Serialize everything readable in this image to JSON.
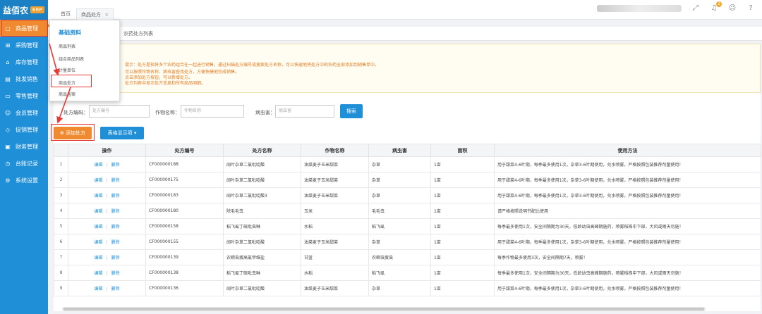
{
  "brand": {
    "name": "益佰农",
    "badge": "ERP"
  },
  "sidebar": {
    "items": [
      {
        "label": "商品管理",
        "icon": "box-icon",
        "active": true
      },
      {
        "label": "采购管理",
        "icon": "cart-icon"
      },
      {
        "label": "库存管理",
        "icon": "warehouse-icon"
      },
      {
        "label": "批发销售",
        "icon": "chart-icon"
      },
      {
        "label": "零售管理",
        "icon": "shop-icon"
      },
      {
        "label": "会员管理",
        "icon": "users-icon"
      },
      {
        "label": "促销管理",
        "icon": "tag-icon"
      },
      {
        "label": "财务管理",
        "icon": "finance-icon"
      },
      {
        "label": "台账记录",
        "icon": "ledger-icon"
      },
      {
        "label": "系统设置",
        "icon": "gear-icon"
      }
    ]
  },
  "topbar": {
    "tabs": [
      {
        "label": "首页"
      },
      {
        "label": "商品处方"
      }
    ],
    "close_glyph": "×",
    "notification_count": "2"
  },
  "subtabs": {
    "active": "农药处方列表"
  },
  "dropdown": {
    "title": "基础资料",
    "items": [
      "商品列表",
      "组合商品列表",
      "计量单位",
      "商品处方",
      "商品备案"
    ]
  },
  "notice": {
    "line1": "提示：处方是指将多个农药组合在一起进行销售，通过扫描处方编号或搜索处方名称，可以快速地将处方中的农药全部添加到销售单中。",
    "line2": "可以按照作物名称、病虫害查找处方，方便快捷地完成销售。",
    "line3": "点击添加处方按钮，可以新增处方。",
    "line4": "处方列表中显示处方信息和所有商品明细。"
  },
  "search": {
    "code_label": "处方编码：",
    "code_placeholder": "处方编号",
    "crop_label": "作物名称：",
    "crop_placeholder": "作物名称",
    "pest_label": "病虫害：",
    "pest_placeholder": "病虫害",
    "button": "搜索"
  },
  "actions": {
    "add": "添加处方",
    "columns": "表格显示项 ▾"
  },
  "table": {
    "headers": [
      "",
      "操作",
      "处方编号",
      "处方名称",
      "作物名称",
      "病虫害",
      "面积",
      "使用方法"
    ],
    "edit_label": "编辑",
    "delete_label": "删除",
    "rows": [
      {
        "n": "1",
        "code": "CF000000188",
        "name": "阔叶杂草二氯吡啶酸",
        "crop": "油菜麦子玉米甜菜",
        "pest": "杂草",
        "area": "1亩",
        "method": "用于甜菜4-6叶期，每季最多使用1次，杂草3-6叶期使用，兑水喷雾，严格按照包装推荐剂量使用！"
      },
      {
        "n": "2",
        "code": "CF000000175",
        "name": "阔叶杂草二氯吡啶酸",
        "crop": "油菜麦子玉米甜菜",
        "pest": "杂草",
        "area": "1亩",
        "method": "用于甜菜4-6叶期，每季最多使用1次，杂草3-6叶期使用，兑水喷雾，严格按照包装推荐剂量使用！"
      },
      {
        "n": "3",
        "code": "CF000000183",
        "name": "阔叶杂草二氯吡啶酸3",
        "crop": "油菜麦子玉米甜菜",
        "pest": "杂草",
        "area": "1亩",
        "method": "用于甜菜4-6叶期，每季最多使用1次，杂草3-6叶期使用，兑水喷雾，严格按照包装推荐剂量使用！"
      },
      {
        "n": "4",
        "code": "CF000000180",
        "name": "除毛毛虫",
        "crop": "玉米",
        "pest": "毛毛虫",
        "area": "1亩",
        "method": "请严格按照说明书配比使用"
      },
      {
        "n": "5",
        "code": "CF000000158",
        "name": "稻飞虱丁硫吡虫啉",
        "crop": "水稻",
        "pest": "稻飞虱",
        "area": "1亩",
        "method": "每季最多使用1次，安全间隔期为30天，低龄幼虫高峰期施药，喷雾稻株中下部，大风或雨天勿施！"
      },
      {
        "n": "6",
        "code": "CF000000155",
        "name": "阔叶杂草二氯吡啶酸",
        "crop": "油菜麦子玉米甜菜",
        "pest": "杂草",
        "area": "1亩",
        "method": "用于甜菜4-6叶期，每季最多使用1次，杂草3-6叶期使用，兑水喷雾，严格按照包装推荐剂量使用！"
      },
      {
        "n": "7",
        "code": "CF000000139",
        "name": "农螟虫蛋高氯甲维盐",
        "crop": "甘蓝",
        "pest": "农螟虫蛋虫",
        "area": "1亩",
        "method": "每季作物最多使用3次，安全间隔期7天，喷雾！"
      },
      {
        "n": "8",
        "code": "CF000000138",
        "name": "稻飞虱丁硫吡虫啉",
        "crop": "水稻",
        "pest": "稻飞虱",
        "area": "1亩",
        "method": "每季最多使用1次，安全间隔期为30天，低龄幼虫高峰期施药，喷雾稻株中下部，大风或雨天勿施！"
      },
      {
        "n": "9",
        "code": "CF000000136",
        "name": "阔叶杂草二氯吡啶酸",
        "crop": "油菜麦子玉米甜菜",
        "pest": "杂草",
        "area": "1亩",
        "method": "用于甜菜4-6叶期，每季最多使用1次，杂草3-6叶期使用，兑水喷雾，严格按照包装推荐剂量使用！"
      }
    ]
  },
  "colors": {
    "primary": "#1f8fd8",
    "accent": "#f08a30",
    "highlight": "#e53935"
  }
}
